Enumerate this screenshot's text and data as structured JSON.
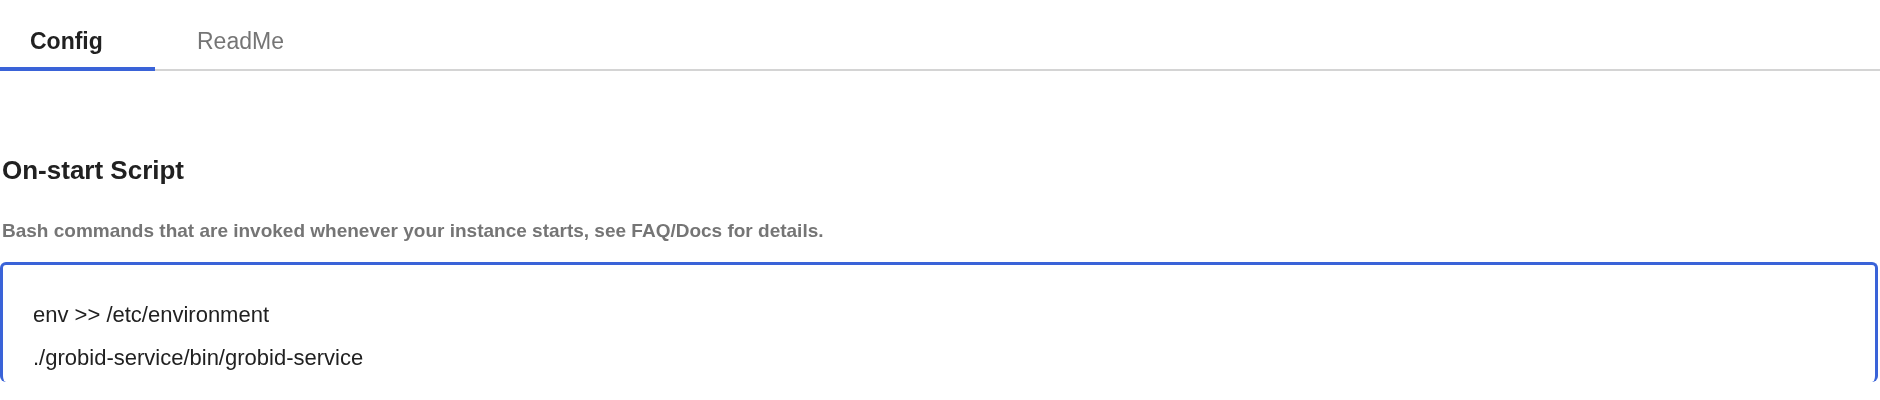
{
  "tabs": [
    {
      "label": "Config",
      "selected": true
    },
    {
      "label": "ReadMe",
      "selected": false
    }
  ],
  "section": {
    "title": "On-start Script",
    "description": "Bash commands that are invoked whenever your instance starts, see FAQ/Docs for details.",
    "script": {
      "lines": [
        "env >> /etc/environment",
        "./grobid-service/bin/grobid-service"
      ],
      "focused": true
    }
  }
}
